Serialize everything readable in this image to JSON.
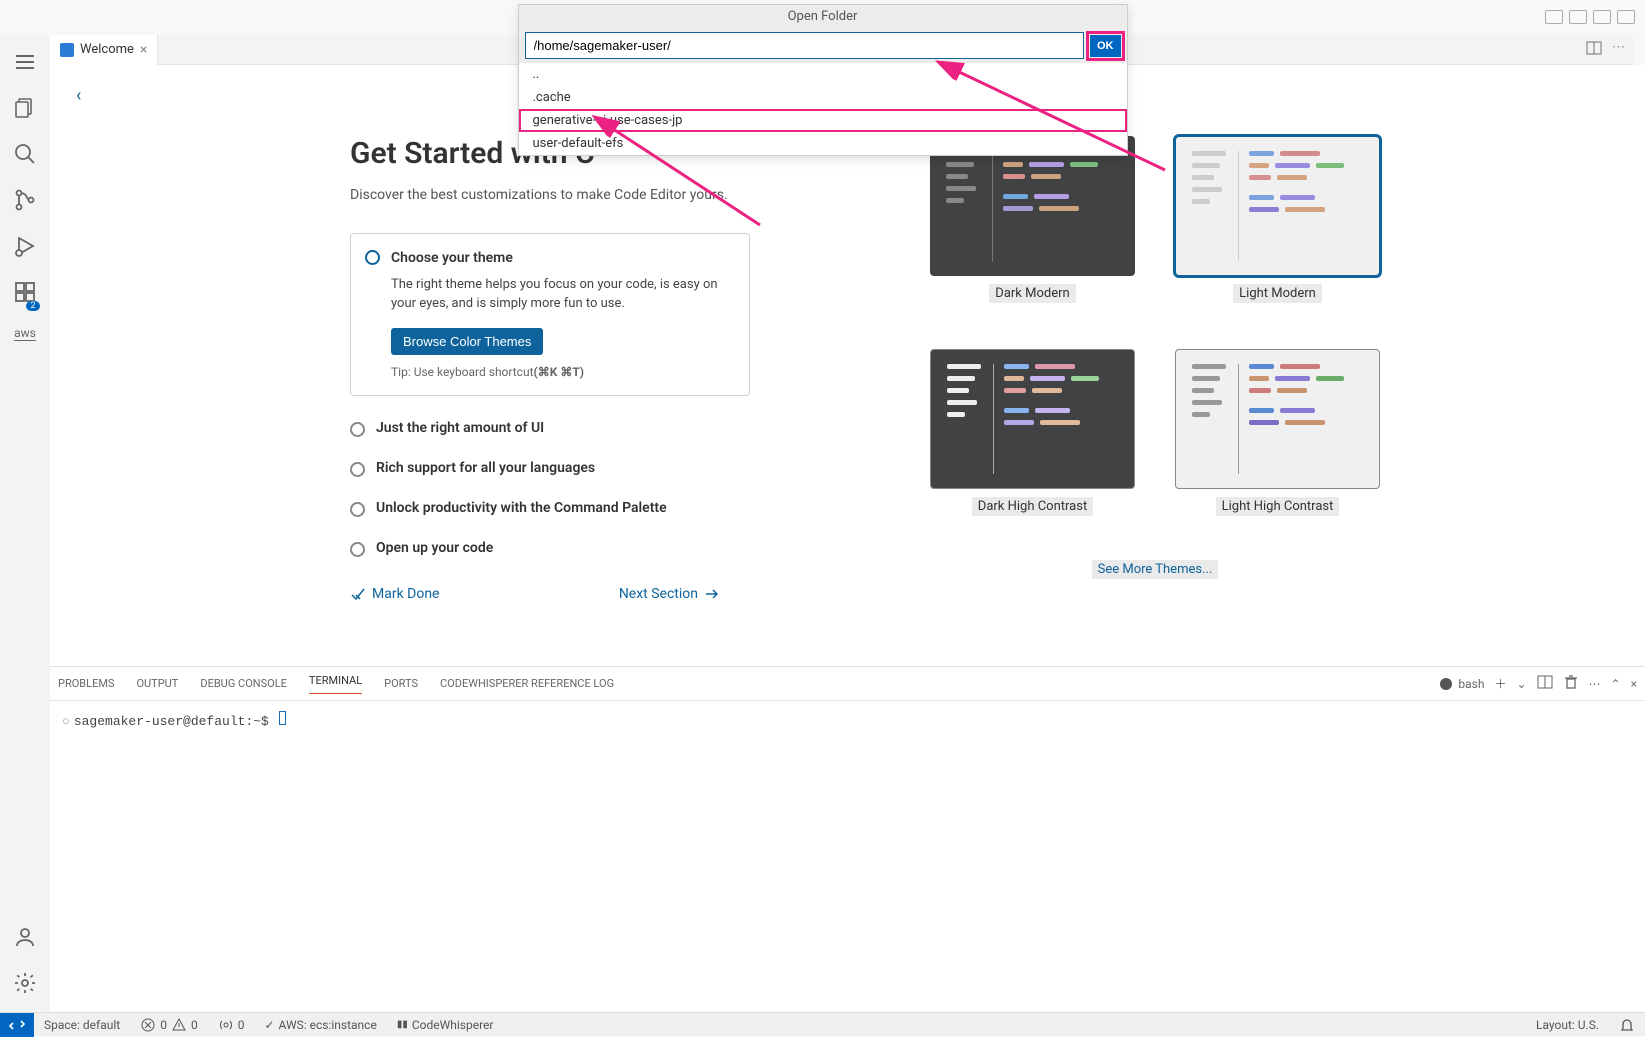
{
  "window": {
    "title": "Open Folder"
  },
  "quick_open": {
    "title": "Open Folder",
    "path": "/home/sagemaker-user/",
    "ok": "OK",
    "items": [
      "..",
      ".cache",
      "generative-ai-use-cases-jp",
      "user-default-efs"
    ],
    "highlight_index": 2
  },
  "tab": {
    "label": "Welcome"
  },
  "activitybar": {
    "extensions_badge": "2",
    "aws_label": "aws"
  },
  "welcome": {
    "title": "Get Started with C",
    "subtitle": "Discover the best customizations to make Code Editor yours.",
    "card": {
      "title": "Choose your theme",
      "body": "The right theme helps you focus on your code, is easy on your eyes, and is simply more fun to use.",
      "button": "Browse Color Themes",
      "tip_prefix": "Tip: Use keyboard shortcut",
      "tip_shortcut": "(⌘K ⌘T)"
    },
    "steps": [
      "Just the right amount of UI",
      "Rich support for all your languages",
      "Unlock productivity with the Command Palette",
      "Open up your code"
    ],
    "mark_done": "Mark Done",
    "next_section": "Next Section"
  },
  "themes": {
    "dark_modern": "Dark Modern",
    "light_modern": "Light Modern",
    "dark_hc": "Dark High Contrast",
    "light_hc": "Light High Contrast",
    "see_more": "See More Themes..."
  },
  "panel": {
    "tabs": [
      "PROBLEMS",
      "OUTPUT",
      "DEBUG CONSOLE",
      "TERMINAL",
      "PORTS",
      "CODEWHISPERER REFERENCE LOG"
    ],
    "active_index": 3,
    "shell": "bash",
    "prompt": "sagemaker-user@default:~$"
  },
  "status": {
    "space": "Space: default",
    "errors": "0",
    "warnings": "0",
    "ports": "0",
    "aws": "AWS: ecs:instance",
    "codewhisperer": "CodeWhisperer",
    "layout": "Layout: U.S."
  }
}
